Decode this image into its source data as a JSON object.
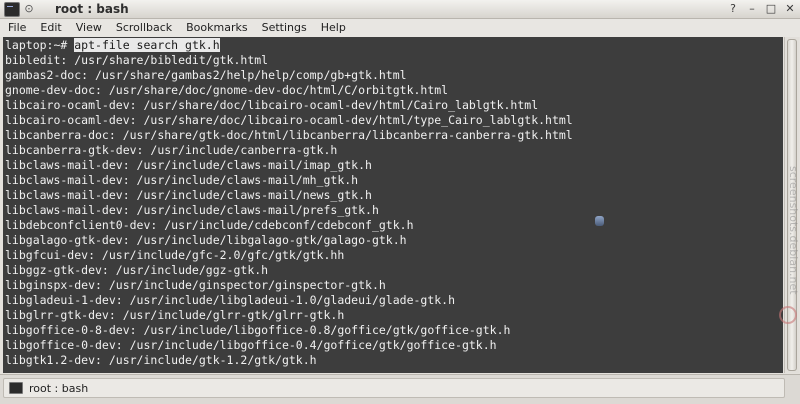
{
  "window": {
    "title": "root : bash"
  },
  "menubar": {
    "items": [
      "File",
      "Edit",
      "View",
      "Scrollback",
      "Bookmarks",
      "Settings",
      "Help"
    ]
  },
  "terminal": {
    "prompt": "laptop:~# ",
    "command": "apt-file search gtk.h",
    "output": [
      "bibledit: /usr/share/bibledit/gtk.html",
      "gambas2-doc: /usr/share/gambas2/help/help/comp/gb+gtk.html",
      "gnome-dev-doc: /usr/share/doc/gnome-dev-doc/html/C/orbitgtk.html",
      "libcairo-ocaml-dev: /usr/share/doc/libcairo-ocaml-dev/html/Cairo_lablgtk.html",
      "libcairo-ocaml-dev: /usr/share/doc/libcairo-ocaml-dev/html/type_Cairo_lablgtk.html",
      "libcanberra-doc: /usr/share/gtk-doc/html/libcanberra/libcanberra-canberra-gtk.html",
      "libcanberra-gtk-dev: /usr/include/canberra-gtk.h",
      "libclaws-mail-dev: /usr/include/claws-mail/imap_gtk.h",
      "libclaws-mail-dev: /usr/include/claws-mail/mh_gtk.h",
      "libclaws-mail-dev: /usr/include/claws-mail/news_gtk.h",
      "libclaws-mail-dev: /usr/include/claws-mail/prefs_gtk.h",
      "libdebconfclient0-dev: /usr/include/cdebconf/cdebconf_gtk.h",
      "libgalago-gtk-dev: /usr/include/libgalago-gtk/galago-gtk.h",
      "libgfcui-dev: /usr/include/gfc-2.0/gfc/gtk/gtk.hh",
      "libggz-gtk-dev: /usr/include/ggz-gtk.h",
      "libginspx-dev: /usr/include/ginspector/ginspector-gtk.h",
      "libgladeui-1-dev: /usr/include/libgladeui-1.0/gladeui/glade-gtk.h",
      "libglrr-gtk-dev: /usr/include/glrr-gtk/glrr-gtk.h",
      "libgoffice-0-8-dev: /usr/include/libgoffice-0.8/goffice/gtk/goffice-gtk.h",
      "libgoffice-0-dev: /usr/include/libgoffice-0.4/goffice/gtk/goffice-gtk.h",
      "libgtk1.2-dev: /usr/include/gtk-1.2/gtk/gtk.h"
    ]
  },
  "tabbar": {
    "tabs": [
      {
        "label": "root : bash"
      }
    ]
  },
  "watermark": "screenshots.debian.net",
  "colors": {
    "terminal_bg": "#3d3d3d",
    "terminal_fg": "#f0f0f0",
    "highlight_bg": "#e9e9e9"
  }
}
